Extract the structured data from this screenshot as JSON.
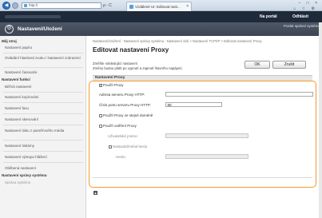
{
  "browser": {
    "url": "http://",
    "url_tools": "ρ - C",
    "tab_label": "Vzdálené UI: Editovat nast...",
    "tab_close": "×",
    "window_controls": "– □ ×",
    "toolbar_icons": "⌂ ☆ ⚙"
  },
  "header": {
    "portal": "Na portál",
    "logout": "Odhlásit",
    "title": "Nastavení/Uložení",
    "admin_link": "Poslat správci systému"
  },
  "sidebar": {
    "sections": [
      {
        "head": "Můj stroj",
        "items": [
          "Nastavení papíru",
          "Ovládání hlasitosti zvuku / Nastavení zobrazení",
          "Nastavení časovače"
        ]
      },
      {
        "head": "Nastavení funkcí",
        "items": [
          "Běžná nastavení",
          "Nastavení kopírování",
          "Nastavení faxu",
          "Nastavení skenování",
          "Nastavení tisku z paměťového média",
          "Nastavení tiskárny",
          "Nastavení výstupu hlášení",
          "Oblíbená nastavení"
        ]
      },
      {
        "head": "Nastavení správy systému",
        "items": [
          "Správa systému"
        ]
      }
    ]
  },
  "main": {
    "breadcrumb": "Nastavení/Uložení : Nastavení správy systému : Nastavení sítě > Nastavení TCP/IP > Editovat nastavení Proxy",
    "title": "Editovat nastavení Proxy",
    "message_line1": "Změňte následující nastavení",
    "message_line2": "Změny budou platit po vypnutí a zapnutí hlavního napájení.",
    "ok_label": "OK",
    "cancel_label": "Zrušit",
    "section_title": "Nastavení Proxy",
    "use_proxy_label": "Použít Proxy",
    "use_proxy_checked": true,
    "proxy_address_label": "Adresa serveru Proxy HTTP:",
    "proxy_address_value": "",
    "proxy_port_label": "Číslo portu serveru Proxy HTTP:",
    "proxy_port_value": "80",
    "same_domain_label": "Použít Proxy ve stejné doméně",
    "same_domain_checked": false,
    "use_auth_label": "Použít ověření Proxy",
    "use_auth_checked": false,
    "username_label": "Uživatelské jméno:",
    "set_password_label": "Nastavit/Změnit heslo",
    "set_password_checked": false,
    "password_label": "Heslo:",
    "to_top_icon": "▲"
  },
  "colors": {
    "highlight": "#f39a2a",
    "header_dark": "#1e2a3a",
    "header_bar": "#4e5866"
  }
}
